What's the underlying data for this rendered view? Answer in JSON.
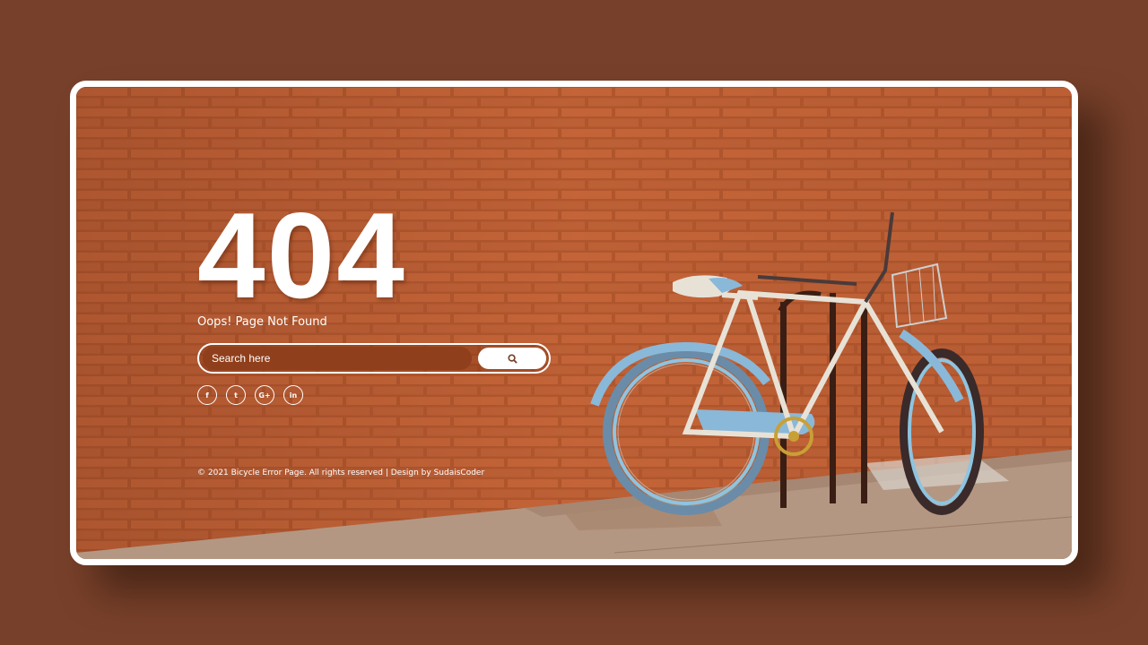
{
  "error": {
    "code": "404",
    "message": "Oops! Page Not Found"
  },
  "search": {
    "placeholder": "Search here",
    "button_icon": "search-icon"
  },
  "social": [
    {
      "name": "facebook",
      "glyph": "f"
    },
    {
      "name": "twitter",
      "glyph": "t"
    },
    {
      "name": "google-plus",
      "glyph": "G+"
    },
    {
      "name": "linkedin",
      "glyph": "in"
    }
  ],
  "footer": {
    "text": "© 2021 Bicycle Error Page. All rights reserved | Design by SudaisCoder"
  },
  "colors": {
    "page_background": "#77402a",
    "brick": "#b0582f",
    "text": "#ffffff",
    "bike_frame": "#e8e2d6",
    "bike_fenders": "#8ab8d8"
  }
}
